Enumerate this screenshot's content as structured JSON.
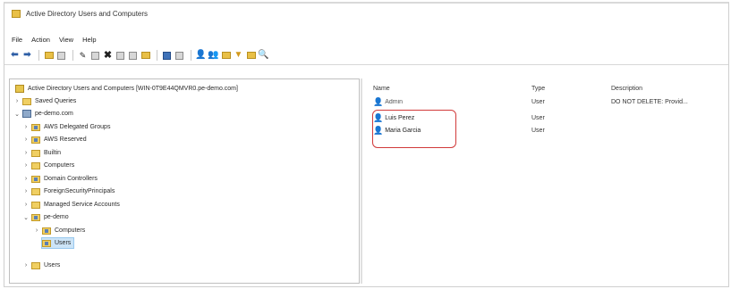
{
  "window": {
    "title": "Active Directory Users and Computers"
  },
  "menu": [
    "File",
    "Action",
    "View",
    "Help"
  ],
  "toolbar_icons": [
    "back-arrow-icon",
    "forward-arrow-icon",
    "folder-up-icon",
    "show-hide-tree-icon",
    "properties-icon",
    "copy-icon",
    "delete-icon",
    "export-list-icon",
    "refresh-icon",
    "help-icon",
    "console-icon",
    "new-user-icon",
    "new-group-icon",
    "new-ou-icon",
    "filter-icon",
    "add-to-group-icon",
    "find-icon"
  ],
  "tree": {
    "root": "Active Directory Users and Computers [WIN-0T9E44QMVR0.pe-demo.com]",
    "items": [
      {
        "label": "Saved Queries",
        "level": 1,
        "expanded": false,
        "type": "folder"
      },
      {
        "label": "pe-demo.com",
        "level": 1,
        "expanded": true,
        "type": "domain"
      },
      {
        "label": "AWS Delegated Groups",
        "level": 2,
        "expanded": false,
        "type": "ou"
      },
      {
        "label": "AWS Reserved",
        "level": 2,
        "expanded": false,
        "type": "ou"
      },
      {
        "label": "Builtin",
        "level": 2,
        "expanded": false,
        "type": "folder"
      },
      {
        "label": "Computers",
        "level": 2,
        "expanded": false,
        "type": "folder"
      },
      {
        "label": "Domain Controllers",
        "level": 2,
        "expanded": false,
        "type": "ou"
      },
      {
        "label": "ForeignSecurityPrincipals",
        "level": 2,
        "expanded": false,
        "type": "folder"
      },
      {
        "label": "Managed Service Accounts",
        "level": 2,
        "expanded": false,
        "type": "folder"
      },
      {
        "label": "pe-demo",
        "level": 2,
        "expanded": true,
        "type": "ou"
      },
      {
        "label": "Computers",
        "level": 3,
        "expanded": false,
        "type": "ou"
      },
      {
        "label": "Users",
        "level": 3,
        "expanded": false,
        "type": "ou",
        "selected": true
      },
      {
        "label": "Users",
        "level": 2,
        "expanded": false,
        "type": "folder"
      }
    ]
  },
  "list": {
    "columns": [
      "Name",
      "Type",
      "Description"
    ],
    "rows": [
      {
        "name": "Admin",
        "type": "User",
        "description": "DO NOT DELETE: Provid..."
      },
      {
        "name": "Luis Perez",
        "type": "User",
        "description": ""
      },
      {
        "name": "Maria Garcia",
        "type": "User",
        "description": ""
      }
    ]
  },
  "colors": {
    "highlight_box": "#d13a3a",
    "selection": "#cce4f7",
    "folder": "#f0cf62"
  }
}
